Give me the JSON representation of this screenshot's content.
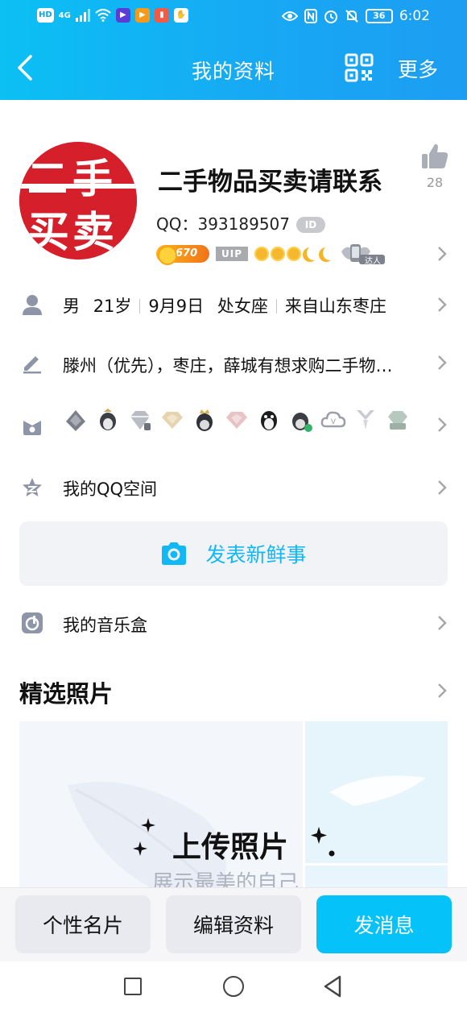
{
  "status_bar": {
    "left_chips": [
      "HD",
      "4G"
    ],
    "battery": "36",
    "time": "6:02"
  },
  "nav": {
    "title": "我的资料",
    "more_label": "更多"
  },
  "profile": {
    "avatar_text_top": "二手",
    "avatar_text_bottom": "买卖",
    "nickname": "二手物品买卖请联系",
    "qq_label": "QQ：393189507",
    "id_badge": "ID",
    "likes": "28",
    "level": "670",
    "vip_label": "UIP",
    "daren_label": "达人"
  },
  "info_row": {
    "gender": "男",
    "age": "21岁",
    "birthday": "9月9日",
    "zodiac": "处女座",
    "hometown": "来自山东枣庄"
  },
  "signature": "滕州（优先），枣庄，薛城有想求购二手物…",
  "medals": [
    "medal-1",
    "medal-2",
    "medal-3",
    "medal-4",
    "medal-5",
    "medal-6",
    "medal-7",
    "medal-8",
    "medal-9",
    "medal-10",
    "medal-11"
  ],
  "qzone_label": "我的QQ空间",
  "post_button_label": "发表新鲜事",
  "music_label": "我的音乐盒",
  "photos": {
    "section_title": "精选照片",
    "upload_title": "上传照片",
    "upload_sub": "展示最美的自己"
  },
  "bottom_bar": {
    "card_label": "个性名片",
    "edit_label": "编辑资料",
    "message_label": "发消息"
  },
  "colors": {
    "accent": "#12b7f5",
    "header_start": "#0bc0f3",
    "header_end": "#1c9df2",
    "avatar_red": "#d51f2a"
  }
}
